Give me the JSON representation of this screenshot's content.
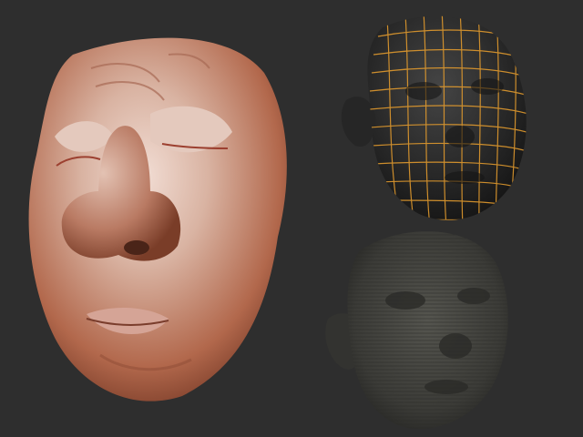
{
  "scene": {
    "background": "#2e2e2e",
    "panels": [
      {
        "id": "skin-render",
        "material": "skin",
        "color": "#c98d72"
      },
      {
        "id": "wireframe-render",
        "material": "dark-matcap",
        "color": "#1f1f1f",
        "wire_color": "#e09a2e"
      },
      {
        "id": "displacement-render",
        "material": "dark-gray",
        "color": "#3a3a38"
      }
    ]
  }
}
